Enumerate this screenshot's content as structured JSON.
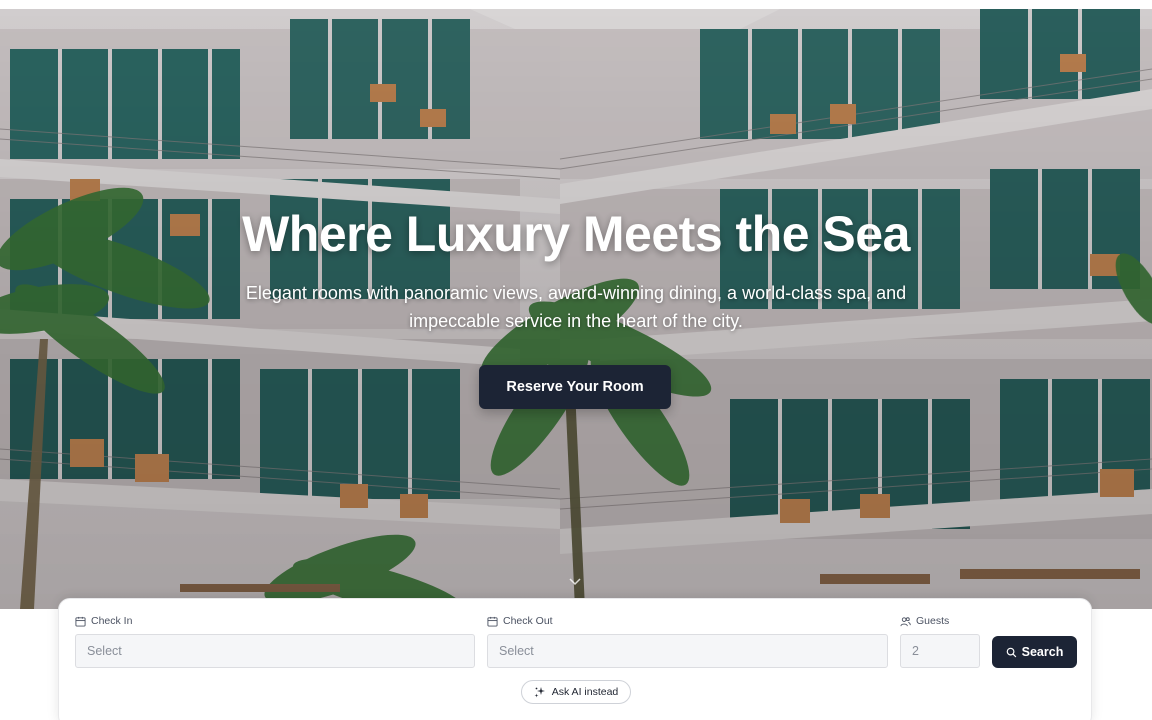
{
  "hero": {
    "title": "Where Luxury Meets the Sea",
    "subtitle": "Elegant rooms with panoramic views, award-winning dining, a world-class spa, and impeccable service in the heart of the city.",
    "cta_label": "Reserve Your Room",
    "scroll_icon": "chevron-down-icon"
  },
  "booking": {
    "check_in": {
      "label": "Check In",
      "placeholder": "Select",
      "icon": "calendar-icon"
    },
    "check_out": {
      "label": "Check Out",
      "placeholder": "Select",
      "icon": "calendar-icon"
    },
    "guests": {
      "label": "Guests",
      "value": "2",
      "icon": "users-icon"
    },
    "search_label": "Search",
    "search_icon": "search-icon",
    "ask_ai_label": "Ask AI instead",
    "ask_ai_icon": "sparkles-icon"
  },
  "colors": {
    "primary": "#1c2435",
    "card_bg": "#ffffff",
    "input_bg": "#f5f6f8",
    "building": "#dcd5d6",
    "glass": "#2e6b68",
    "palm": "#3d7a3a"
  }
}
